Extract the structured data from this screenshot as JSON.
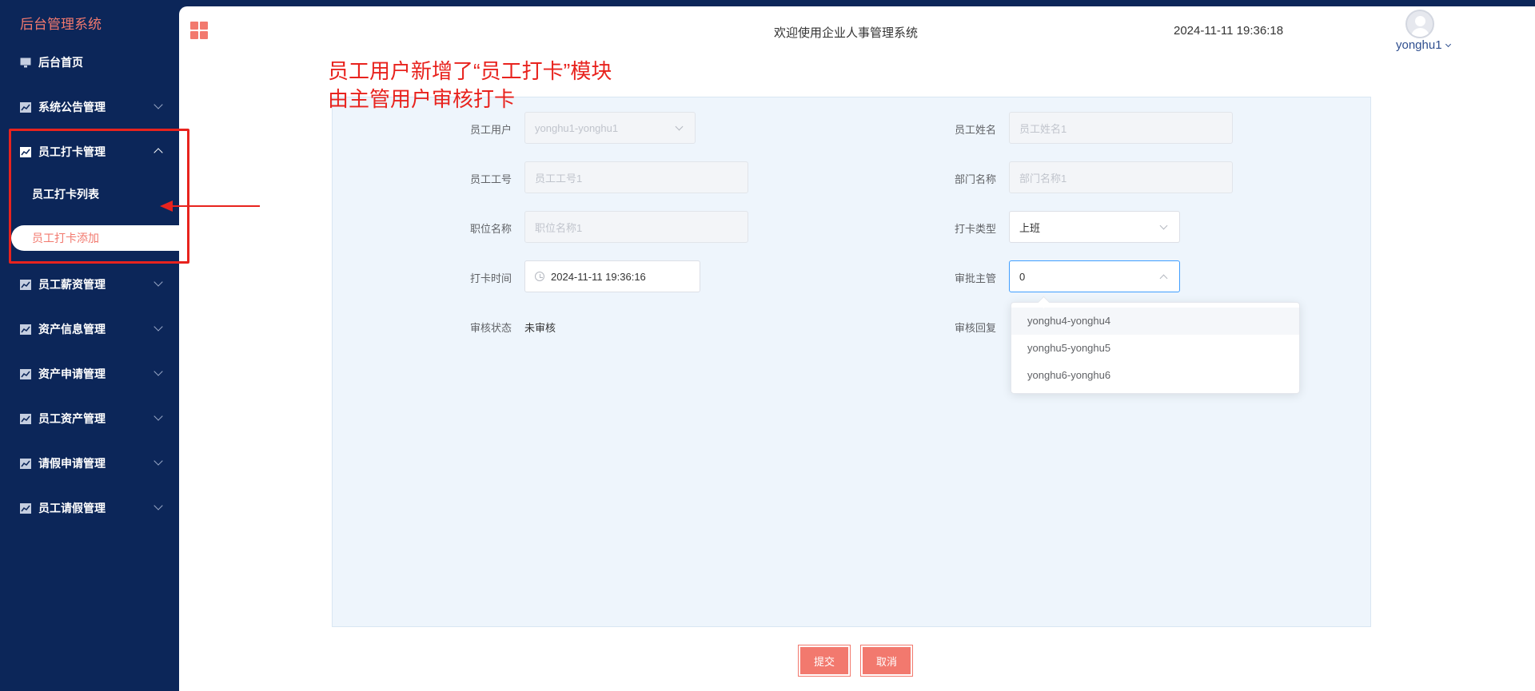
{
  "sidebar": {
    "brand": "后台管理系统",
    "home": "后台首页",
    "menus": [
      "系统公告管理",
      "员工打卡管理",
      "员工薪资管理",
      "资产信息管理",
      "资产申请管理",
      "员工资产管理",
      "请假申请管理",
      "员工请假管理"
    ],
    "sub_items": [
      "员工打卡列表",
      "员工打卡添加"
    ]
  },
  "header": {
    "title": "欢迎使用企业人事管理系统",
    "datetime": "2024-11-11 19:36:18",
    "username": "yonghu1"
  },
  "annotation": {
    "text": "员工用户新增了“员工打卡”模块\n由主管用户审核打卡"
  },
  "form": {
    "labels": {
      "user": "员工用户",
      "name": "员工姓名",
      "job_no": "员工工号",
      "dept": "部门名称",
      "position": "职位名称",
      "punch_type": "打卡类型",
      "punch_time": "打卡时间",
      "approver": "审批主管",
      "audit_status": "审核状态",
      "audit_reply": "审核回复"
    },
    "values": {
      "user": "yonghu1-yonghu1",
      "name_placeholder": "员工姓名1",
      "job_no_placeholder": "员工工号1",
      "dept_placeholder": "部门名称1",
      "position_placeholder": "职位名称1",
      "punch_type": "上班",
      "punch_time": "2024-11-11 19:36:16",
      "approver": "0",
      "audit_status": "未审核"
    },
    "approver_options": [
      "yonghu4-yonghu4",
      "yonghu5-yonghu5",
      "yonghu6-yonghu6"
    ]
  },
  "buttons": {
    "submit": "提交",
    "cancel": "取消"
  },
  "colors": {
    "sidebar_bg": "#0c2659",
    "accent": "#f2796e",
    "annotation_red": "#e8231e",
    "focus_blue": "#409eff"
  }
}
